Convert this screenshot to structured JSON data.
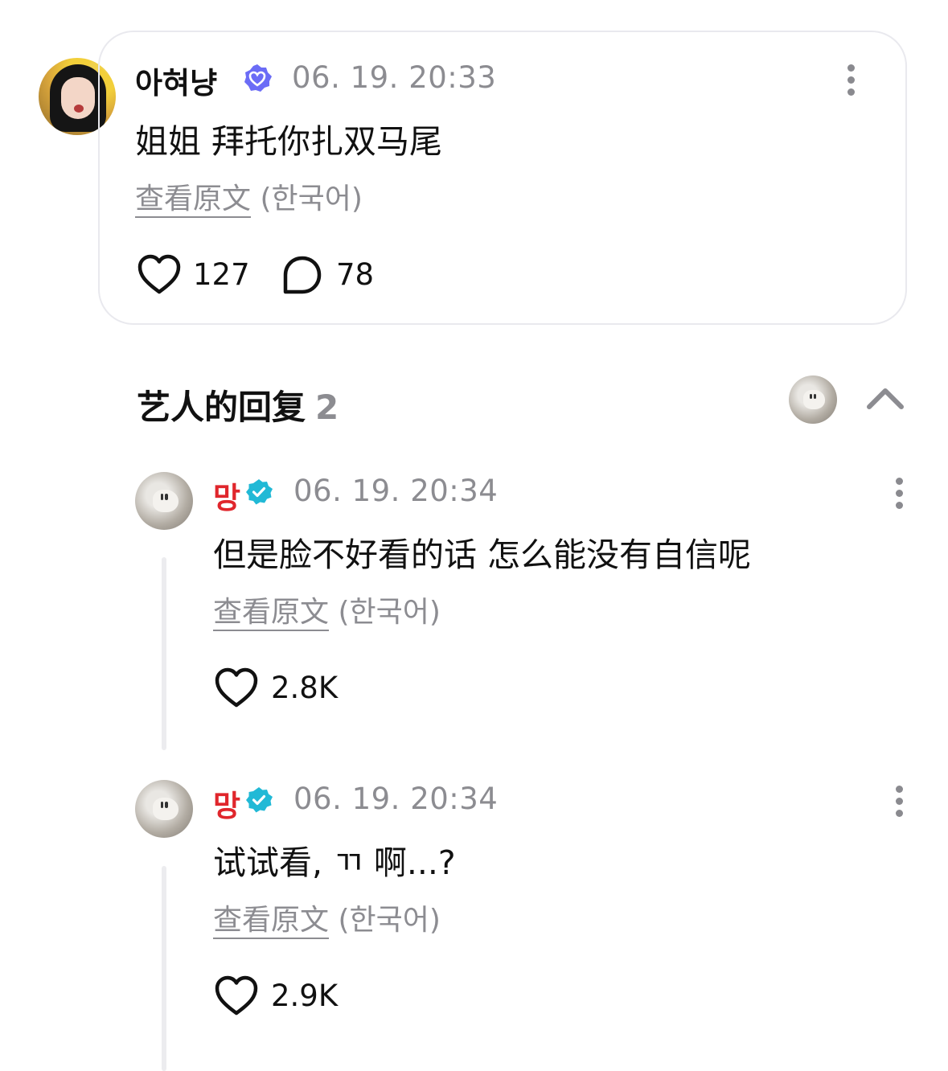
{
  "main_comment": {
    "username": "아혀냥",
    "timestamp": "06. 19. 20:33",
    "text": "姐姐 拜托你扎双马尾",
    "translate_link": "查看原文",
    "translate_lang": "(한국어)",
    "likes": "127",
    "replies": "78",
    "verified_badge_color": "#6b6cf6"
  },
  "artist_replies": {
    "title": "艺人的回复",
    "count": "2",
    "items": [
      {
        "name": "망",
        "timestamp": "06. 19. 20:34",
        "text": "但是脸不好看的话 怎么能没有自信呢",
        "translate_link": "查看原文",
        "translate_lang": "(한국어)",
        "likes": "2.8K"
      },
      {
        "name": "망",
        "timestamp": "06. 19. 20:34",
        "text": "试试看, ㄲ 啊...?",
        "translate_link": "查看原文",
        "translate_lang": "(한국어)",
        "likes": "2.9K"
      }
    ]
  },
  "colors": {
    "artist_name": "#e0262c",
    "artist_badge": "#21b9d6",
    "muted_text": "#8c8c91",
    "card_border": "#e9e9ee"
  }
}
